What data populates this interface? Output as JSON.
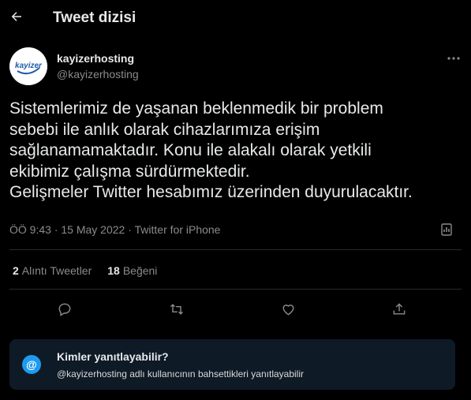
{
  "header": {
    "title": "Tweet dizisi",
    "back_icon": "arrow-left-icon"
  },
  "author": {
    "name": "kayizerhosting",
    "handle": "@kayizerhosting",
    "avatar_logo_text": "kayizer"
  },
  "tweet": {
    "lines": [
      "Sistemlerimiz de yaşanan beklenmedik bir problem",
      "sebebi ile anlık olarak cihazlarımıza erişim",
      "sağlanamamaktadır. Konu ile alakalı olarak yetkili",
      "ekibimiz çalışma sürdürmektedir.",
      "Gelişmeler Twitter hesabımız üzerinden duyurulacaktır."
    ],
    "time": "ÖÖ 9:43",
    "date": "15 May 2022",
    "source": "Twitter for iPhone",
    "separator": "·"
  },
  "stats": {
    "quotes_count": "2",
    "quotes_label": "Alıntı Tweetler",
    "likes_count": "18",
    "likes_label": "Beğeni"
  },
  "actions": [
    "reply-icon",
    "retweet-icon",
    "like-icon",
    "share-icon"
  ],
  "reply_restriction": {
    "icon": "at-icon",
    "at_symbol": "@",
    "title": "Kimler yanıtlayabilir?",
    "subtitle": "@kayizerhosting adlı kullanıcının bahsettikleri yanıtlayabilir"
  },
  "colors": {
    "background": "#000000",
    "accent": "#1d9bf0",
    "secondary_text": "#8b8b8b",
    "reply_box": "#0f1a27"
  }
}
